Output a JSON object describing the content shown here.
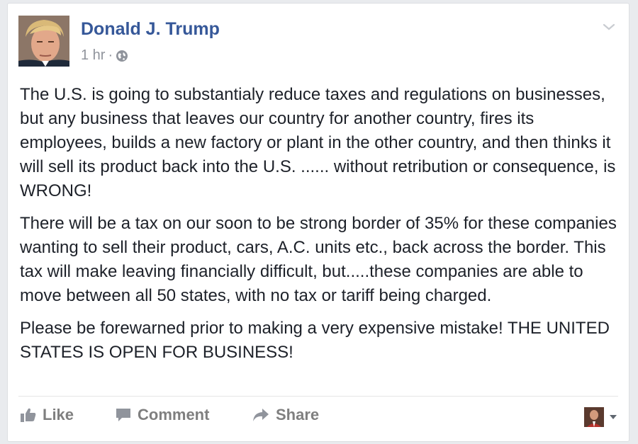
{
  "post": {
    "author": "Donald J. Trump",
    "time": "1 hr",
    "separator": "·",
    "privacy_icon": "globe-icon",
    "paragraphs": [
      "The U.S. is going to substantialy reduce taxes and regulations on businesses, but any business that leaves our country for another country, fires its employees, builds a new factory or plant in the other country, and then thinks it will sell its product back into the U.S. ...... without retribution or consequence, is WRONG!",
      "There will be a tax on our soon to be strong border of 35% for these companies wanting to sell their product, cars, A.C. units etc., back across the border. This tax will make leaving financially difficult, but.....these companies are able to move between all 50 states, with no tax or tariff being charged.",
      "Please be forewarned prior to making a very expensive mistake! THE UNITED STATES IS OPEN FOR BUSINESS!"
    ]
  },
  "actions": {
    "like": "Like",
    "comment": "Comment",
    "share": "Share"
  },
  "colors": {
    "author": "#365899",
    "meta": "#90949c",
    "text": "#1d2129",
    "action": "#7f7f7f"
  }
}
